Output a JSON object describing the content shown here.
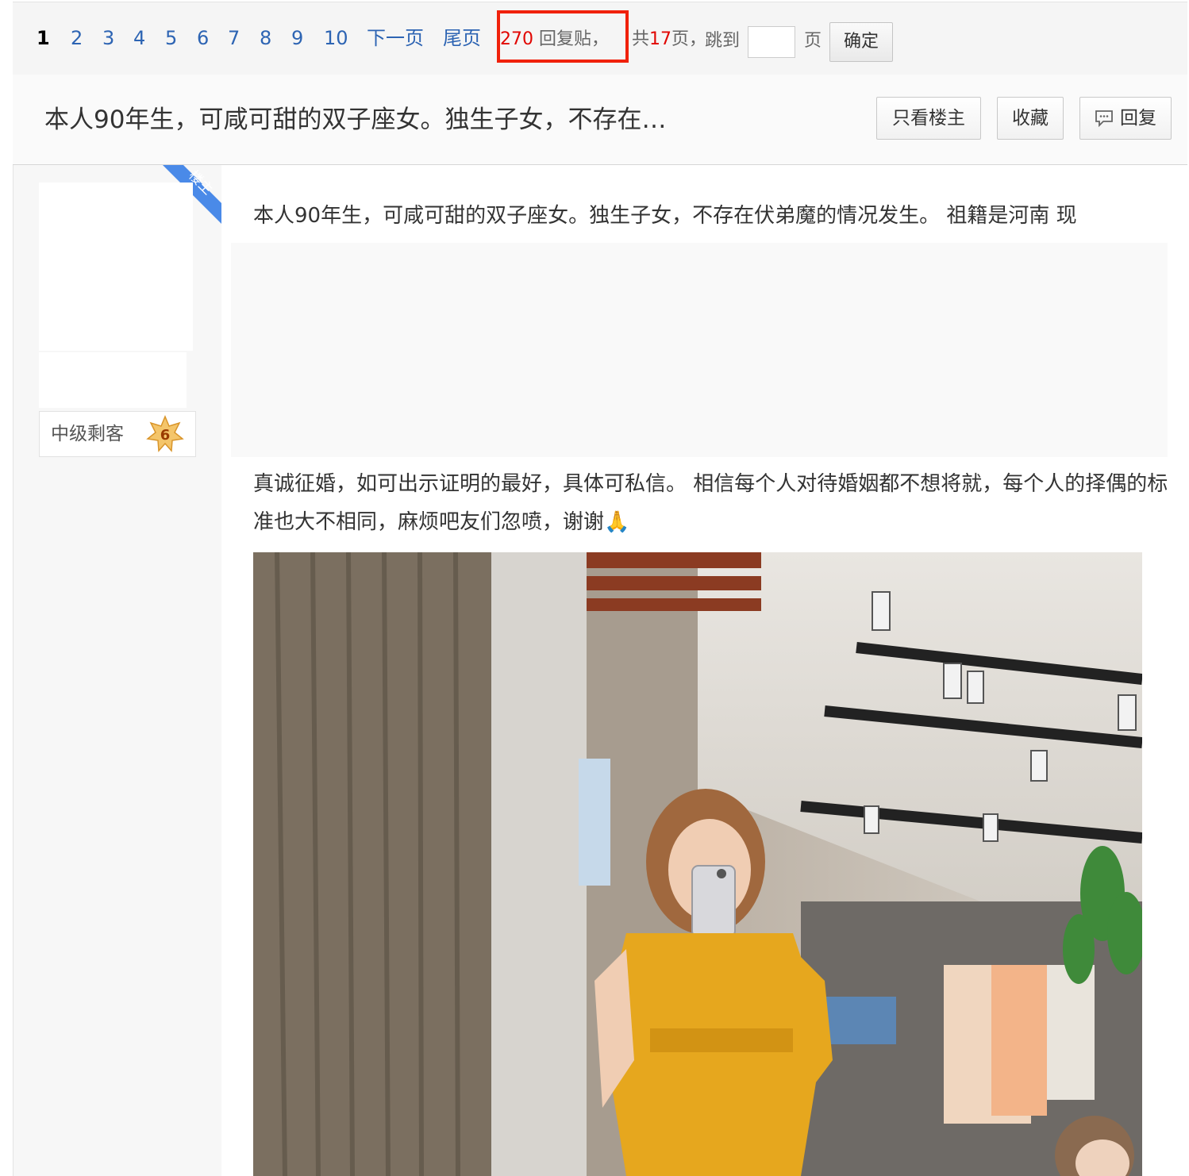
{
  "pager": {
    "current": "1",
    "pages": [
      "2",
      "3",
      "4",
      "5",
      "6",
      "7",
      "8",
      "9",
      "10"
    ],
    "next": "下一页",
    "last": "尾页",
    "reply_count": "270",
    "reply_suffix": "回复贴，",
    "total_prefix": "共",
    "total_pages": "17",
    "total_suffix": "页，",
    "jump_label": "跳到",
    "jump_unit": "页",
    "confirm": "确定"
  },
  "thread": {
    "title": "本人90年生，可咸可甜的双子座女。独生子女，不存在…",
    "only_op_button": "只看楼主",
    "favorite_button": "收藏",
    "reply_button": "回复"
  },
  "author": {
    "badge_text": "楼主",
    "level_name": "中级剩客",
    "level_number": "6"
  },
  "post": {
    "line1": "本人90年生，可咸可甜的双子座女。独生子女，不存在伏弟魔的情况发生。 祖籍是河南 现",
    "line2": "真诚征婚，如可出示证明的最好，具体可私信。 相信每个人对待婚姻都不想将就，每个人的择偶的标准也大不相同，麻烦吧友们忽喷，谢谢🙏"
  },
  "colors": {
    "link": "#2d64b3",
    "highlight": "#f0210b",
    "count_red": "#e10602",
    "ribbon": "#4a8ae8"
  }
}
